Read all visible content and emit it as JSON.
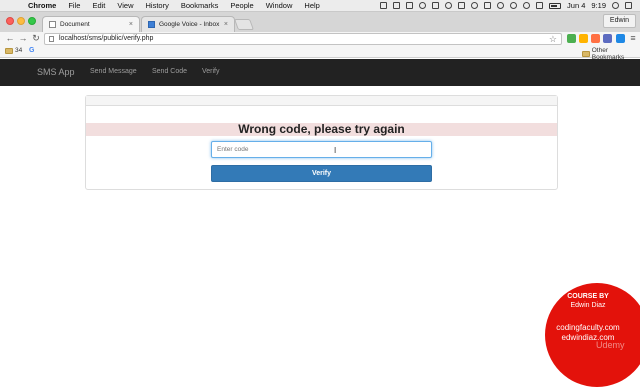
{
  "menubar": {
    "app": "Chrome",
    "items": [
      "File",
      "Edit",
      "View",
      "History",
      "Bookmarks",
      "People",
      "Window",
      "Help"
    ],
    "date": "Jun 4",
    "time": "9:19"
  },
  "browser": {
    "tabs": [
      {
        "title": "Document",
        "close": "×"
      },
      {
        "title": "Google Voice - Inbox",
        "close": "×"
      }
    ],
    "profile": "Edwin",
    "url": "localhost/sms/public/verify.php",
    "bookmarks": {
      "first": "34",
      "other": "Other Bookmarks"
    }
  },
  "site": {
    "brand": "SMS App",
    "nav": [
      "Send Message",
      "Send Code",
      "Verify"
    ]
  },
  "form": {
    "error": "Wrong code, please try again",
    "placeholder": "Enter code",
    "button": "Verify"
  },
  "watermark": {
    "line1": "COURSE BY",
    "line2": "Edwin Diaz",
    "line3": "codingfaculty.com",
    "line4": "edwindiaz.com",
    "corner": "Udemy"
  },
  "colors": {
    "navbar": "#222222",
    "alert_bg": "#f2dede",
    "button": "#337ab7",
    "watermark": "#e3120b"
  }
}
